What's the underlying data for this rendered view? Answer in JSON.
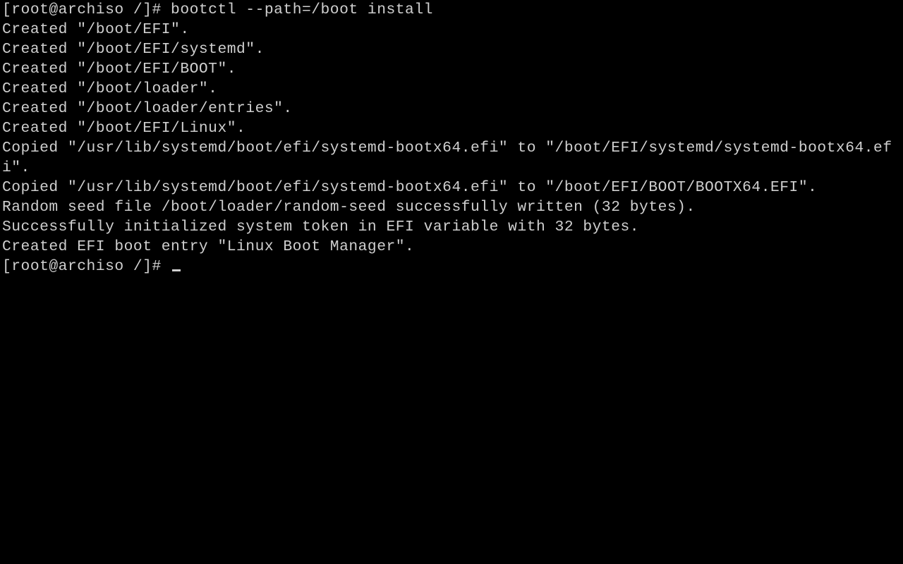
{
  "terminal": {
    "prompt1": "[root@archiso /]# ",
    "command": "bootctl --path=/boot install",
    "output": [
      "Created \"/boot/EFI\".",
      "Created \"/boot/EFI/systemd\".",
      "Created \"/boot/EFI/BOOT\".",
      "Created \"/boot/loader\".",
      "Created \"/boot/loader/entries\".",
      "Created \"/boot/EFI/Linux\".",
      "Copied \"/usr/lib/systemd/boot/efi/systemd-bootx64.efi\" to \"/boot/EFI/systemd/systemd-bootx64.efi\".",
      "Copied \"/usr/lib/systemd/boot/efi/systemd-bootx64.efi\" to \"/boot/EFI/BOOT/BOOTX64.EFI\".",
      "Random seed file /boot/loader/random-seed successfully written (32 bytes).",
      "Successfully initialized system token in EFI variable with 32 bytes.",
      "Created EFI boot entry \"Linux Boot Manager\"."
    ],
    "prompt2": "[root@archiso /]# "
  }
}
